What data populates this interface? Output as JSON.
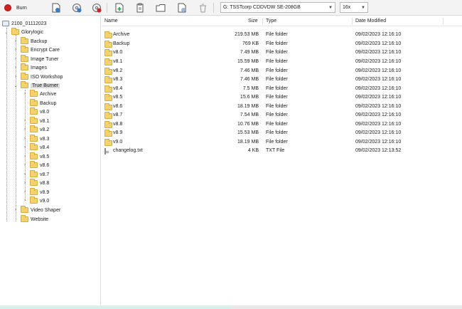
{
  "toolbar": {
    "burn_label": "Burn",
    "drive_value": "G: TSSTcorp CDDVDW SE-208GB",
    "speed_value": "16x",
    "icons": [
      "new-project-icon",
      "add-disc-icon",
      "remove-disc-icon",
      "add-file-icon",
      "paste-icon",
      "new-folder-icon",
      "properties-icon",
      "delete-icon"
    ],
    "accent_color": "#d61f1f"
  },
  "tree": {
    "root": "2100_01112023",
    "items": [
      {
        "label": "Glorylogic"
      },
      {
        "label": "Backup"
      },
      {
        "label": "Encrypt Care"
      },
      {
        "label": "Image Tuner"
      },
      {
        "label": "Images"
      },
      {
        "label": "ISO Workshop"
      },
      {
        "label": "True Burner"
      },
      {
        "label": "Archive"
      },
      {
        "label": "Backup"
      },
      {
        "label": "v8.0"
      },
      {
        "label": "v8.1"
      },
      {
        "label": "v8.2"
      },
      {
        "label": "v8.3"
      },
      {
        "label": "v8.4"
      },
      {
        "label": "v8.5"
      },
      {
        "label": "v8.6"
      },
      {
        "label": "v8.7"
      },
      {
        "label": "v8.8"
      },
      {
        "label": "v8.9"
      },
      {
        "label": "v9.0"
      },
      {
        "label": "Video Shaper"
      },
      {
        "label": "Website"
      }
    ]
  },
  "list": {
    "columns": {
      "name": "Name",
      "size": "Size",
      "type": "Type",
      "date": "Date Modified"
    },
    "rows": [
      {
        "name": "Archive",
        "size": "219.53 MB",
        "type": "File folder",
        "date": "09/02/2023 12:16:10"
      },
      {
        "name": "Backup",
        "size": "769 KB",
        "type": "File folder",
        "date": "09/02/2023 12:16:10"
      },
      {
        "name": "v8.0",
        "size": "7.49 MB",
        "type": "File folder",
        "date": "09/02/2023 12:16:10"
      },
      {
        "name": "v8.1",
        "size": "15.59 MB",
        "type": "File folder",
        "date": "09/02/2023 12:16:10"
      },
      {
        "name": "v8.2",
        "size": "7.46 MB",
        "type": "File folder",
        "date": "09/02/2023 12:16:10"
      },
      {
        "name": "v8.3",
        "size": "7.46 MB",
        "type": "File folder",
        "date": "09/02/2023 12:16:10"
      },
      {
        "name": "v8.4",
        "size": "7.5 MB",
        "type": "File folder",
        "date": "09/02/2023 12:16:10"
      },
      {
        "name": "v8.5",
        "size": "15.6 MB",
        "type": "File folder",
        "date": "09/02/2023 12:16:10"
      },
      {
        "name": "v8.6",
        "size": "18.19 MB",
        "type": "File folder",
        "date": "09/02/2023 12:16:10"
      },
      {
        "name": "v8.7",
        "size": "7.54 MB",
        "type": "File folder",
        "date": "09/02/2023 12:16:10"
      },
      {
        "name": "v8.8",
        "size": "10.76 MB",
        "type": "File folder",
        "date": "09/02/2023 12:16:10"
      },
      {
        "name": "v8.9",
        "size": "15.53 MB",
        "type": "File folder",
        "date": "09/02/2023 12:16:10"
      },
      {
        "name": "v9.0",
        "size": "18.19 MB",
        "type": "File folder",
        "date": "09/02/2023 12:16:10"
      },
      {
        "name": "changelog.txt",
        "size": "4 KB",
        "type": "TXT File",
        "date": "09/02/2023 12:13:52"
      }
    ]
  }
}
